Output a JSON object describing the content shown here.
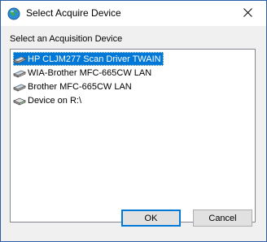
{
  "window": {
    "title": "Select Acquire Device",
    "close_glyph": "✕"
  },
  "group_label": "Select an Acquisition Device",
  "devices": [
    {
      "label": "HP CLJM277 Scan Driver TWAIN",
      "icon": "scanner-icon",
      "selected": true
    },
    {
      "label": "WIA-Brother MFC-665CW LAN",
      "icon": "scanner-icon",
      "selected": false
    },
    {
      "label": "Brother MFC-665CW LAN",
      "icon": "scanner-icon",
      "selected": false
    },
    {
      "label": "Device on R:\\",
      "icon": "drive-icon",
      "selected": false
    }
  ],
  "buttons": {
    "ok": "OK",
    "cancel": "Cancel"
  },
  "colors": {
    "selection": "#0078d7",
    "border": "#2b5fa8"
  }
}
